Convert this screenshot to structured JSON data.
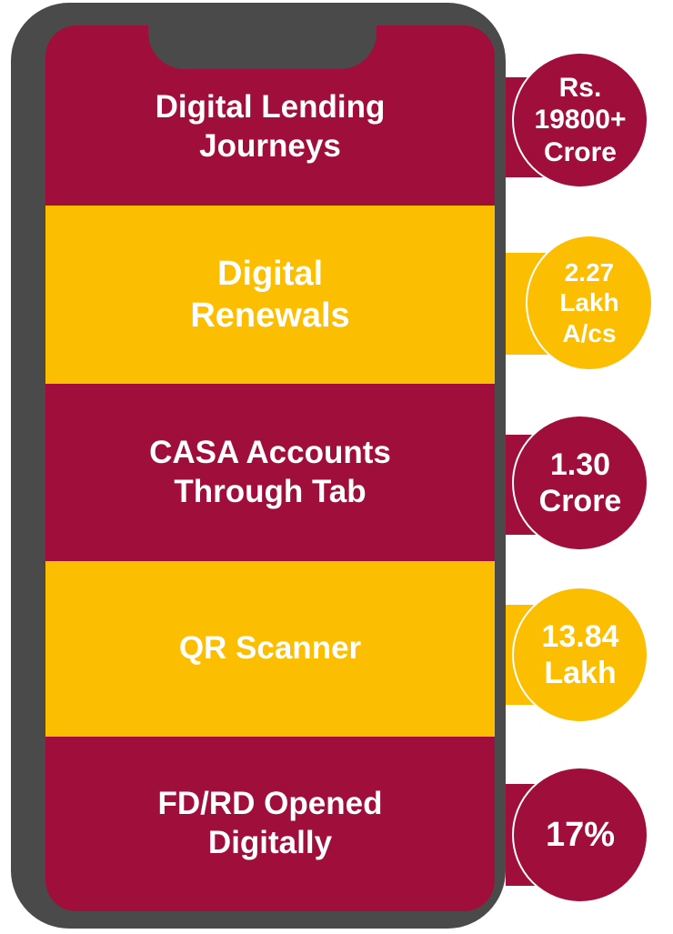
{
  "colors": {
    "maroon": "#a00f3c",
    "gold": "#fcbe00",
    "phone_frame": "#4a4a4a",
    "text": "#ffffff"
  },
  "rows": [
    {
      "label": "Digital Lending\nJourneys",
      "value": "Rs.\n19800+\nCrore",
      "color": "maroon"
    },
    {
      "label": "Digital\nRenewals",
      "value": "2.27\nLakh\nA/cs",
      "color": "gold"
    },
    {
      "label": "CASA Accounts\nThrough Tab",
      "value": "1.30\nCrore",
      "color": "maroon"
    },
    {
      "label": "QR Scanner",
      "value": "13.84\nLakh",
      "color": "gold"
    },
    {
      "label": "FD/RD Opened\nDigitally",
      "value": "17%",
      "color": "maroon"
    }
  ]
}
